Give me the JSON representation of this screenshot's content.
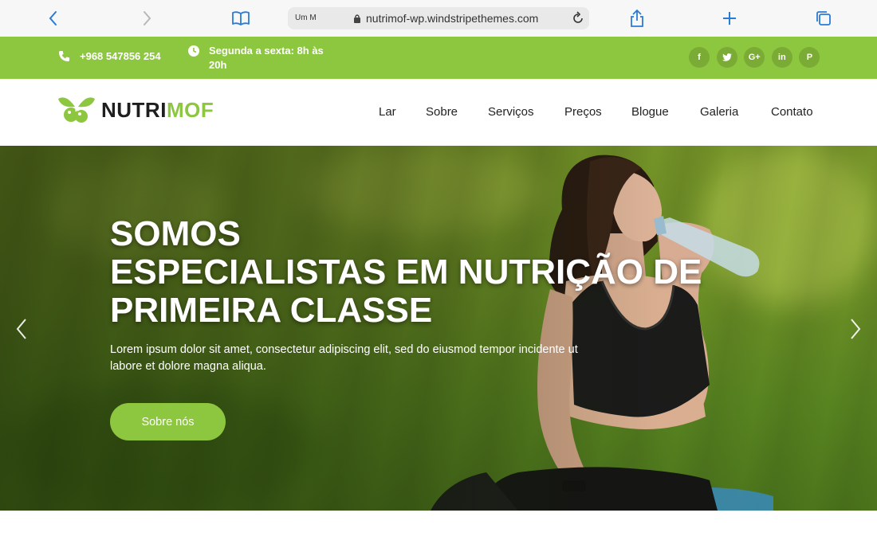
{
  "browser": {
    "reader_label": "Um\nM",
    "url": "nutrimof-wp.windstripethemes.com"
  },
  "topbar": {
    "phone": "+968 547856 254",
    "hours": "Segunda a sexta: 8h às 20h",
    "socials": [
      {
        "icon": "facebook-icon",
        "glyph": "f"
      },
      {
        "icon": "twitter-icon",
        "glyph": "t"
      },
      {
        "icon": "google-plus-icon",
        "glyph": "G+"
      },
      {
        "icon": "linkedin-icon",
        "glyph": "in"
      },
      {
        "icon": "pinterest-icon",
        "glyph": "P"
      }
    ],
    "color": "#8dc63f"
  },
  "header": {
    "logo_part1": "NUTRI",
    "logo_part2": "MOF",
    "menu": [
      "Lar",
      "Sobre",
      "Serviços",
      "Preços",
      "Blogue",
      "Galeria",
      "Contato"
    ]
  },
  "hero": {
    "title_line1": "SOMOS",
    "title_line2": "ESPECIALISTAS EM NUTRIÇÃO DE",
    "title_line3": "PRIMEIRA CLASSE",
    "text": "Lorem ipsum dolor sit amet, consectetur adipiscing elit, sed do eiusmod tempor incidente ut labore et dolore magna aliqua.",
    "button": "Sobre nós"
  },
  "colors": {
    "accent": "#8dc63f",
    "dark": "#1e1e1e"
  }
}
